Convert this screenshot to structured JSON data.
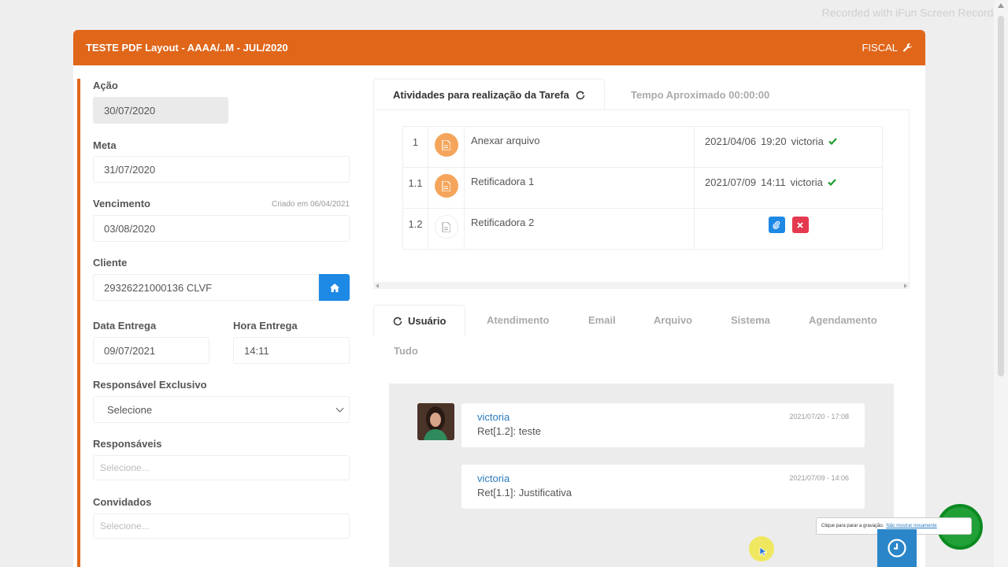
{
  "watermark": "Recorded with iFun Screen Recorder",
  "header": {
    "title": "TESTE PDF Layout - AAAA/..M - JUL/2020",
    "section": "FISCAL",
    "section_icon": "wrench-icon"
  },
  "form": {
    "acao": {
      "label": "Ação",
      "value": "30/07/2020"
    },
    "meta": {
      "label": "Meta",
      "value": "31/07/2020"
    },
    "vencimento": {
      "label": "Vencimento",
      "note": "Criado em 06/04/2021",
      "value": "03/08/2020"
    },
    "cliente": {
      "label": "Cliente",
      "value": "29326221000136 CLVF",
      "button_icon": "home-icon"
    },
    "data_entrega": {
      "label": "Data Entrega",
      "value": "09/07/2021"
    },
    "hora_entrega": {
      "label": "Hora Entrega",
      "value": "14:11"
    },
    "responsavel_exclusivo": {
      "label": "Responsável Exclusivo",
      "value": "Selecione"
    },
    "responsaveis": {
      "label": "Responsáveis",
      "placeholder": "Selecione..."
    },
    "convidados": {
      "label": "Convidados",
      "placeholder": "Selecione..."
    }
  },
  "activity_tabs": {
    "active": "Atividades para realização da Tarefa",
    "inactive": "Tempo Aproximado 00:00:00",
    "refresh_icon": "refresh-icon"
  },
  "activities": [
    {
      "num": "1",
      "name": "Anexar arquivo",
      "status": "done",
      "date": "2021/04/06",
      "time": "19:20",
      "user": "victoria"
    },
    {
      "num": "1.1",
      "name": "Retificadora 1",
      "status": "done",
      "date": "2021/07/09",
      "time": "14:11",
      "user": "victoria"
    },
    {
      "num": "1.2",
      "name": "Retificadora 2",
      "status": "pending"
    }
  ],
  "bottom_tabs": {
    "usuario": "Usuário",
    "atendimento": "Atendimento",
    "email": "Email",
    "arquivo": "Arquivo",
    "sistema": "Sistema",
    "agendamento": "Agendamento",
    "tudo": "Tudo"
  },
  "messages": [
    {
      "user": "victoria",
      "text": "Ret[1.2]: teste",
      "date": "2021/07/20 - 17:08"
    },
    {
      "user": "victoria",
      "text": "Ret[1.1]: Justificativa",
      "date": "2021/07/09 - 14:06"
    }
  ],
  "recorder_tooltip": {
    "text": "Clique para parar a gravação.",
    "link": "Não mostrar novamente"
  },
  "colors": {
    "accent": "#e0661a",
    "primary": "#1e88e5",
    "danger": "#e53950",
    "success": "#1f9c2c"
  }
}
